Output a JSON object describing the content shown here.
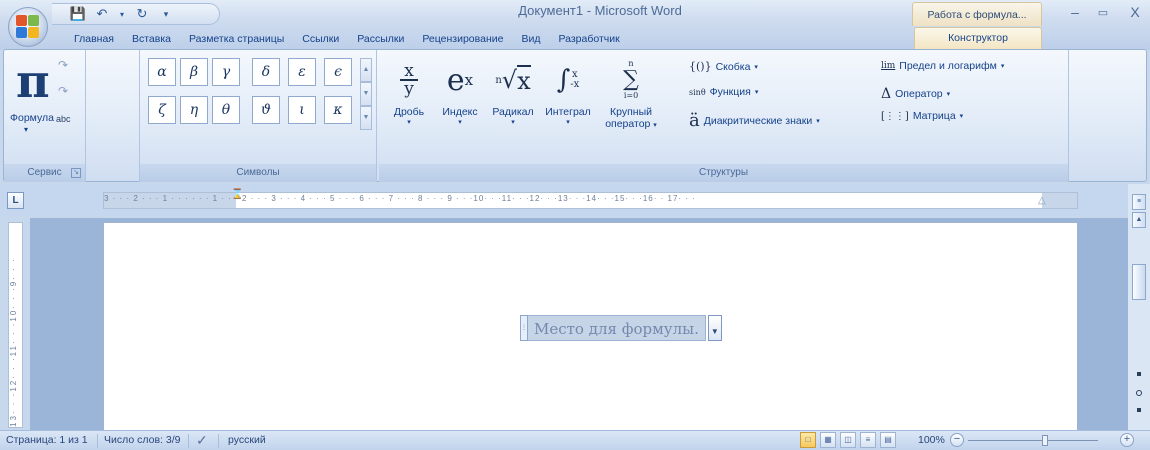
{
  "window": {
    "title": "Документ1 - Microsoft Word",
    "context_group_title": "Работа с формула..."
  },
  "tabs": [
    {
      "label": "Главная"
    },
    {
      "label": "Вставка"
    },
    {
      "label": "Разметка страницы"
    },
    {
      "label": "Ссылки"
    },
    {
      "label": "Рассылки"
    },
    {
      "label": "Рецензирование"
    },
    {
      "label": "Вид"
    },
    {
      "label": "Разработчик"
    }
  ],
  "active_tab": "Конструктор",
  "ribbon": {
    "service": {
      "formula_label": "Формула",
      "group_label": "Сервис",
      "abc_label": "abc"
    },
    "symbols": {
      "group_label": "Символы",
      "items": [
        "α",
        "β",
        "γ",
        "δ",
        "ε",
        "ϵ",
        "ζ",
        "η",
        "θ",
        "ϑ",
        "ι",
        "κ"
      ]
    },
    "structures": {
      "group_label": "Структуры",
      "fraction_label": "Дробь",
      "index_label": "Индекс",
      "radical_label": "Радикал",
      "integral_label": "Интеграл",
      "large_operator_label": "Крупный",
      "large_operator_label2": "оператор",
      "bracket_label": "Скобка",
      "function_label": "Функция",
      "accent_label": "Диакритические знаки",
      "limit_label": "Предел и логарифм",
      "operator_label": "Оператор",
      "matrix_label": "Матрица"
    }
  },
  "ruler": {
    "h_text": "3 · · · 2 · · · 1 · · ·   · · · 1 · · · 2 · · · 3 · · · 4 · · · 5 · · · 6 · · · 7 · · · 8 · · · 9 · · ·10· · ·11· · ·12· · ·13· · ·14· · ·15· · ·16· ·  17· · ·",
    "v_text": "13· · ·12· · ·11· · ·10· · ·9· · ·"
  },
  "document": {
    "equation_placeholder": "Место для формулы."
  },
  "statusbar": {
    "page": "Страница: 1 из 1",
    "words": "Число слов: 3/9",
    "language": "русский",
    "zoom": "100%"
  },
  "colors": {
    "ribbon_bg": "#dfe9f6",
    "context_tab": "#f3e6c4",
    "page": "#ffffff"
  }
}
